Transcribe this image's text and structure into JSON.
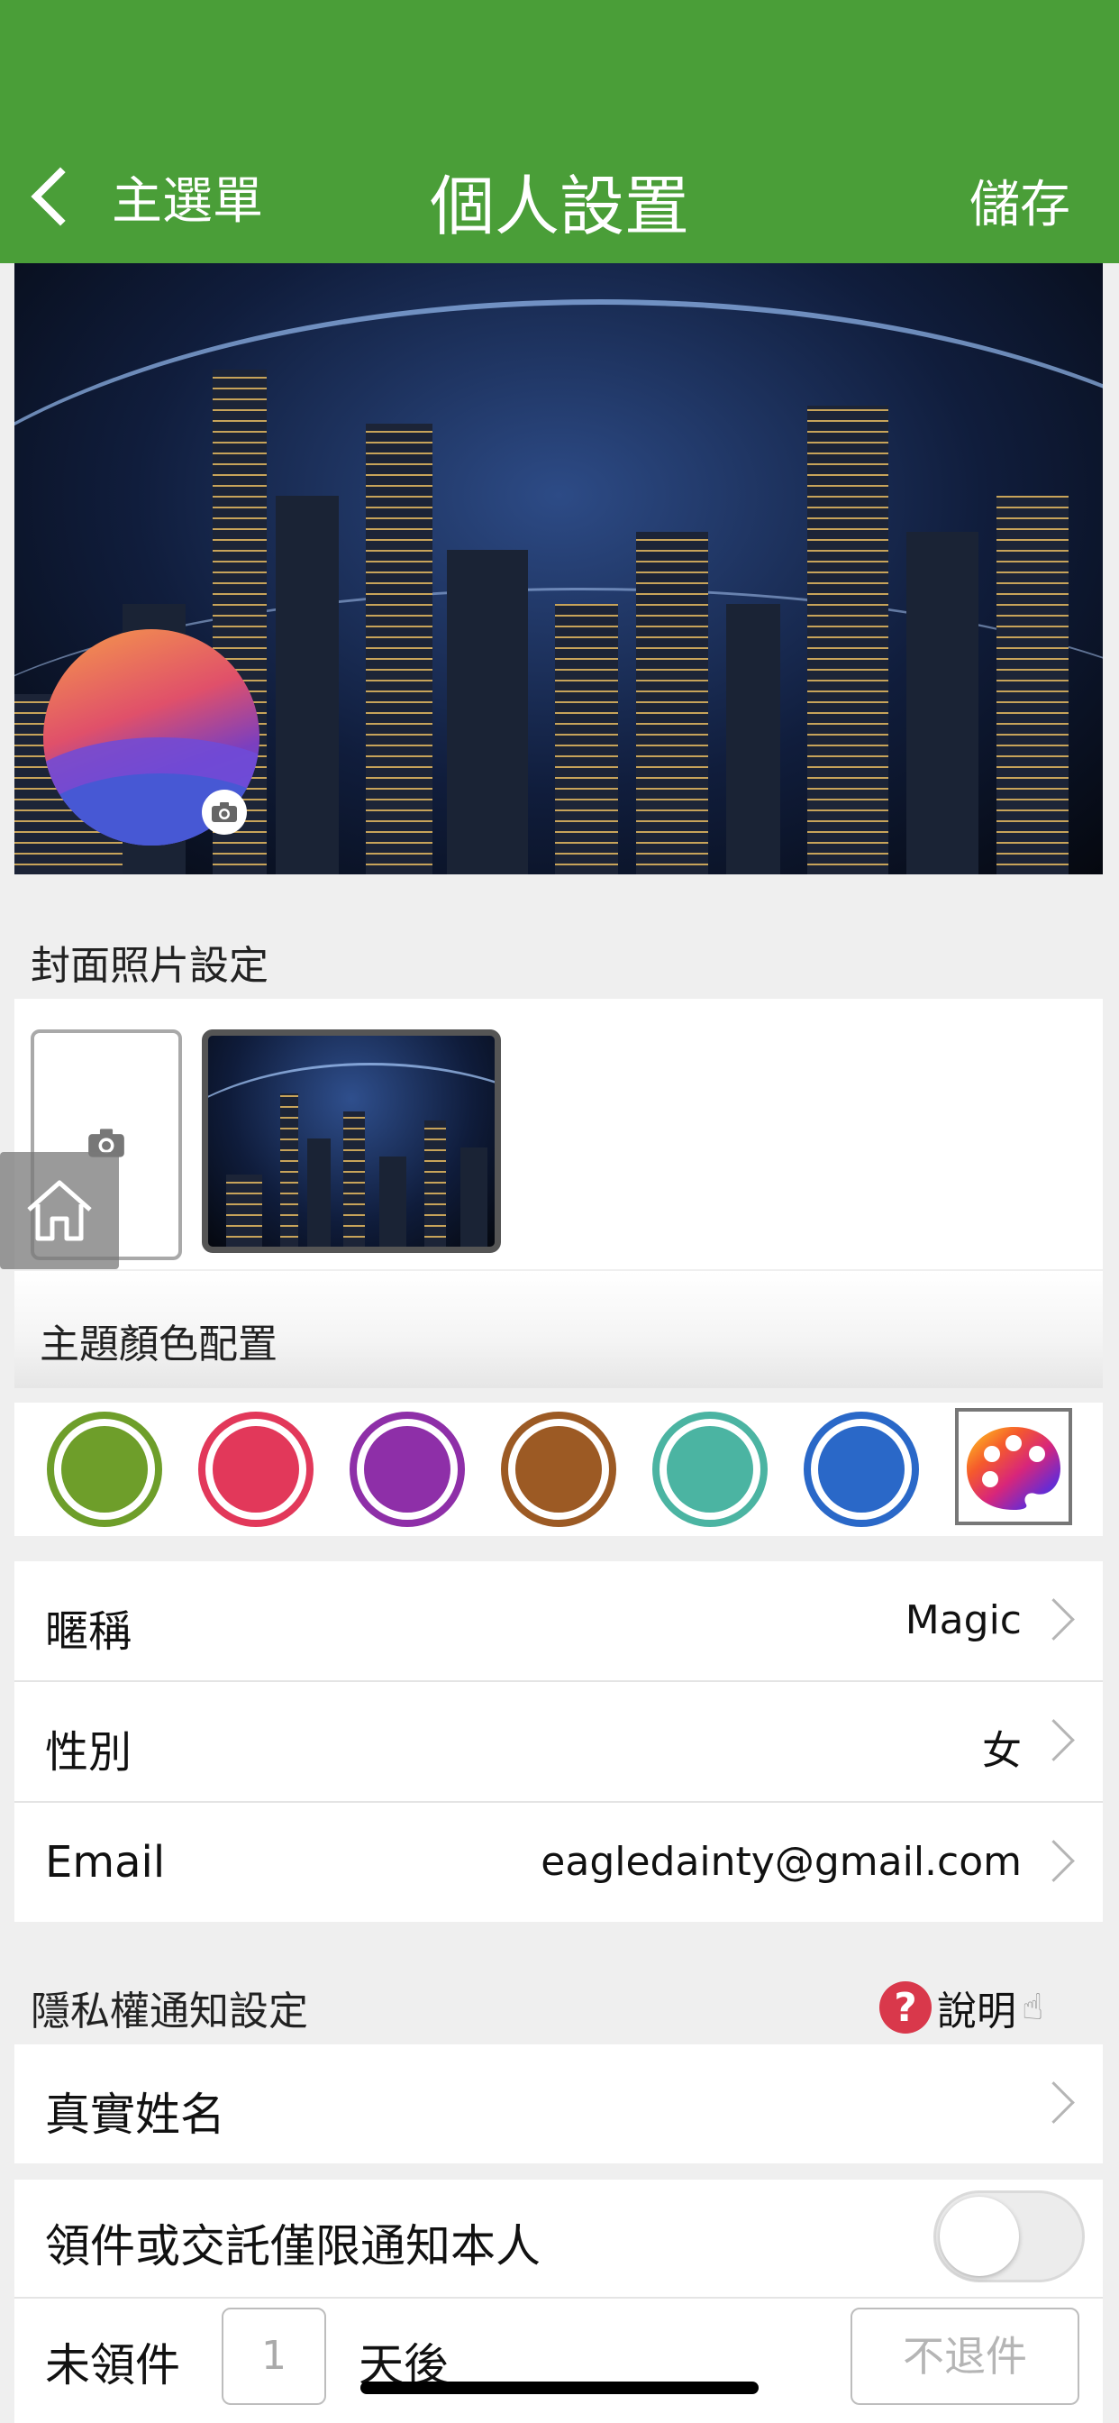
{
  "header": {
    "back_label": "主選單",
    "title": "個人設置",
    "save_label": "儲存"
  },
  "cover": {
    "section_title": "封面照片設定"
  },
  "theme": {
    "section_title": "主題顏色配置",
    "swatches": [
      {
        "name": "green",
        "color": "#6e9e2a"
      },
      {
        "name": "red",
        "color": "#e2385a"
      },
      {
        "name": "purple",
        "color": "#8e2fa8"
      },
      {
        "name": "brown",
        "color": "#9c5a24"
      },
      {
        "name": "teal",
        "color": "#4bb4a2"
      },
      {
        "name": "blue",
        "color": "#2a68c8"
      }
    ],
    "custom_icon": "palette-icon"
  },
  "profile": {
    "nickname_label": "暱稱",
    "nickname_value": "Magic",
    "gender_label": "性別",
    "gender_value": "女",
    "email_label": "Email",
    "email_value": "eagledainty@gmail.com"
  },
  "privacy": {
    "section_title": "隱私權通知設定",
    "help_icon": "?",
    "help_label": "說明",
    "real_name_label": "真實姓名",
    "notify_self_label": "領件或交託僅限通知本人",
    "notify_self_enabled": false,
    "unclaimed_label": "未領件",
    "days_value": "1",
    "days_suffix": "天後",
    "return_label": "不退件"
  },
  "colors": {
    "brand_green": "#4a9e38"
  }
}
